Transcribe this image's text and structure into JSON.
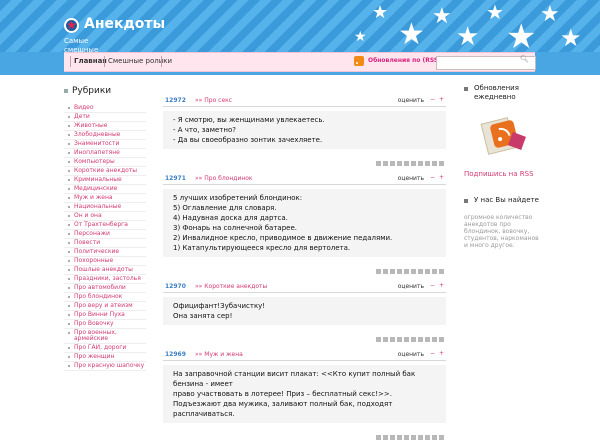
{
  "site": {
    "title": "Анекдоты",
    "subtitle": "Самые смешные анекдоты"
  },
  "nav": {
    "items": [
      {
        "label": "Главная"
      },
      {
        "label": "Смешные ролики"
      }
    ],
    "rss_label": "Обновления по (RSS)",
    "search_placeholder": ""
  },
  "sidebar_left": {
    "title": "Рубрики",
    "items": [
      "Видео",
      "Дети",
      "Животные",
      "Злободневные",
      "Знаменитости",
      "Иноплапетяне",
      "Компьютеры",
      "Короткие анекдоты",
      "Криминальные",
      "Медицинские",
      "Муж и жена",
      "Национальные",
      "Он и она",
      "От Трахтенберга",
      "Персонажи",
      "Повести",
      "Политические",
      "Похоронные",
      "Пошлые анекдоты",
      "Праздники, застолья",
      "Про автомобили",
      "Про блондинок",
      "Про веру и атеизм",
      "Про Винни Пуха",
      "Про Вовочку",
      "Про военных, армейские",
      "Про ГАИ, дороги",
      "Про женщин",
      "Про красную шапочку"
    ]
  },
  "posts": [
    {
      "id": "12972",
      "cat_prefix": "»»",
      "category": "Про секс",
      "rate_label": "оценить",
      "minus": "−",
      "plus": "+",
      "lines": [
        "- Я смотрю, вы женщинами увлекаетесь.",
        "- А что, заметно?",
        "- Да вы своеобразно зонтик зачехляете."
      ]
    },
    {
      "id": "12971",
      "cat_prefix": "»»",
      "category": "Про блондинок",
      "rate_label": "оценить",
      "minus": "−",
      "plus": "+",
      "lines": [
        "5 лучших изобретений блондинок:",
        "5) Оглавление для словаря.",
        "4) Надувная доска для дартса.",
        "3) Фонарь на солнечной батарее.",
        "2) Инвалидное кресло, приводимое в движение педалями.",
        "1) Катапультирующееся кресло для вертолета."
      ]
    },
    {
      "id": "12970",
      "cat_prefix": "»»",
      "category": "Короткие анекдоты",
      "rate_label": "оценить",
      "minus": "−",
      "plus": "+",
      "lines": [
        "Официфант!Зубачистку!",
        "Она занята сер!"
      ]
    },
    {
      "id": "12969",
      "cat_prefix": "»»",
      "category": "Муж и жена",
      "rate_label": "оценить",
      "minus": "−",
      "plus": "+",
      "lines": [
        "На заправочной станции висит плакат: <<Кто купит полный бак бензина - имеет",
        "право участвовать в лотерее! Приз – бесплатный секс!>>.",
        "Подъезжают два мужика, заливают полный бак, подходят расплачиваться."
      ]
    }
  ],
  "sidebar_right": {
    "updates_title": "Обновления ежедневно",
    "rss_link": "Подпишись на RSS",
    "about_title": "У нас Вы найдете",
    "about_text": "огромное количество анекдотов про блондинок, вовочку, студентов, наркоманов и много другое."
  },
  "colors": {
    "header_blue": "#4aa6e2",
    "accent_pink": "#d23a72",
    "link_blue": "#3a7ec2",
    "nav_bg": "#ffe6ee"
  }
}
